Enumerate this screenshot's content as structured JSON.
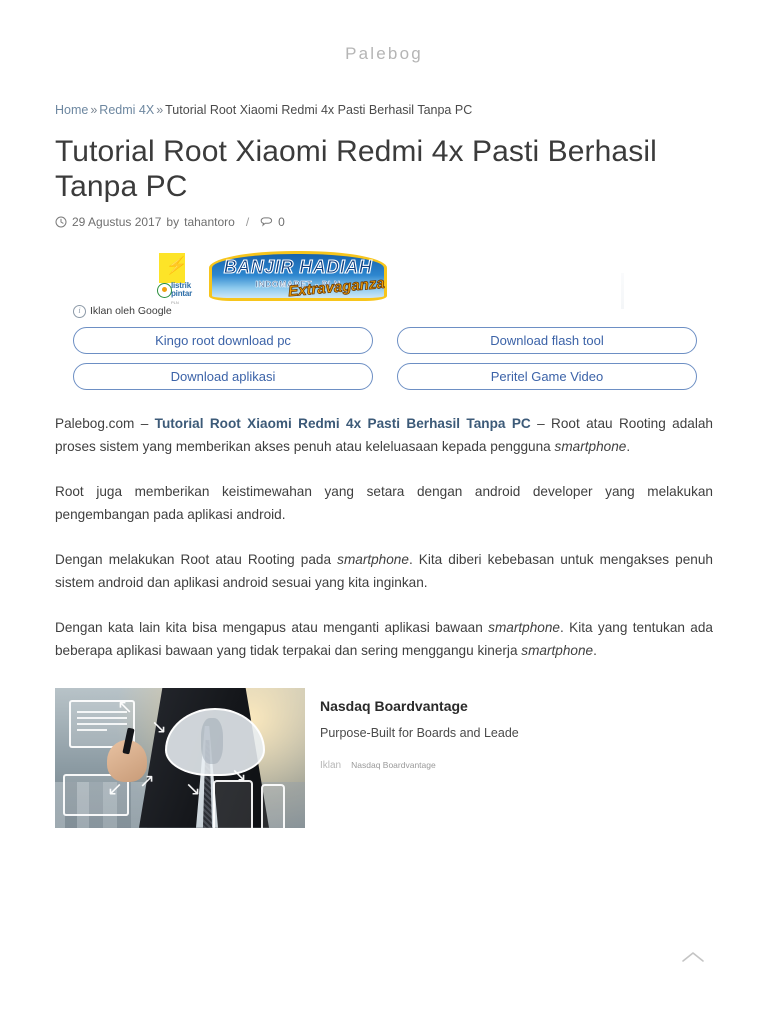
{
  "site": {
    "title": "Palebog"
  },
  "breadcrumb": {
    "home": "Home",
    "sep1": "»",
    "category": "Redmi 4X",
    "sep2": "»",
    "current": "Tutorial Root Xiaomi Redmi 4x Pasti Berhasil Tanpa PC"
  },
  "post": {
    "title": "Tutorial Root Xiaomi Redmi 4x Pasti Berhasil Tanpa PC",
    "date": "29 Agustus 2017",
    "by": "by",
    "author": "tahantoro",
    "divider": "/",
    "comments": "0",
    "clock_icon": "clock-icon",
    "comment_icon": "comment-bubble-icon"
  },
  "ad_top": {
    "banner": {
      "logo_brand": "listrik",
      "logo_brand2": "pintar",
      "logo_sub": "PLN",
      "line1": "BANJIR HADIAH",
      "line2": "INDOMARET - PLN",
      "line3": "Extravaganza"
    },
    "label": "Iklan oleh Google",
    "info_icon": "info-circle-icon",
    "links": [
      "Kingo root download pc",
      "Download flash tool",
      "Download aplikasi",
      "Peritel Game Video"
    ]
  },
  "article": {
    "p1": {
      "prefix": "Palebog.com – ",
      "link": "Tutorial Root Xiaomi Redmi 4x Pasti Berhasil Tanpa PC",
      "mid": " –  Root atau Rooting adalah proses sistem yang memberikan akses penuh atau keleluasaan kepada pengguna ",
      "em": "smartphone",
      "suffix": "."
    },
    "p2": "Root juga memberikan keistimewahan yang setara dengan android developer yang melakukan pengembangan pada aplikasi android.",
    "p3": {
      "pre": "Dengan melakukan Root atau Rooting pada ",
      "em": "smartphone",
      "post": ". Kita diberi kebebasan untuk mengakses penuh sistem  android dan aplikasi android sesuai yang kita inginkan."
    },
    "p4": {
      "pre": "Dengan kata lain kita bisa mengapus atau menganti aplikasi bawaan ",
      "em1": "smartphone",
      "mid": ". Kita yang tentukan ada beberapa aplikasi bawaan yang tidak terpakai dan sering menggangu kinerja ",
      "em2": "smartphone",
      "post": "."
    }
  },
  "ad_bottom": {
    "headline": "Nasdaq Boardvantage",
    "subline": "Purpose-Built for Boards and Leade",
    "tag": "Iklan",
    "advertiser": "Nasdaq Boardvantage",
    "image_alt": "businessman-cloud-computing-illustration"
  },
  "scroll_top": {
    "icon": "chevron-up-icon"
  },
  "colors": {
    "accent_link": "#3c5a78",
    "ad_link_blue": "#3c63a8",
    "breadcrumb_link": "#6d87a0",
    "site_title": "#b5b5b5",
    "body_text": "#3f3f3f"
  }
}
